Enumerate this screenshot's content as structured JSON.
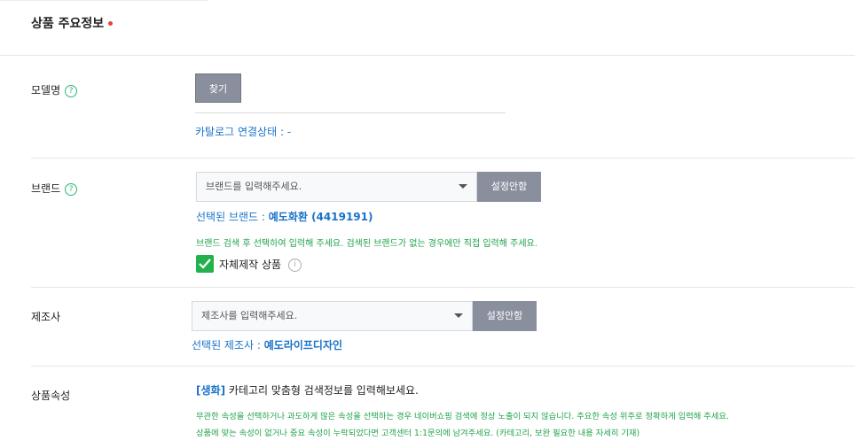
{
  "section": {
    "title": "상품 주요정보"
  },
  "model": {
    "label": "모델명",
    "help_icon": "?",
    "find_button": "찾기",
    "catalog_status": "카탈로그 연결상태 : -"
  },
  "brand": {
    "label": "브랜드",
    "help_icon": "?",
    "placeholder": "브랜드를 입력해주세요.",
    "set_button": "설정안함",
    "selected_prefix": "선택된 브랜드 : ",
    "selected_value": "예도화환 (4419191)",
    "guide": "브랜드 검색 후 선택하여 입력해 주세요. 검색된 브랜드가 없는 경우에만 직접 입력해 주세요.",
    "self_made_label": "자체제작 상품",
    "self_made_checked": true,
    "info_icon": "i"
  },
  "manufacturer": {
    "label": "제조사",
    "placeholder": "제조사를 입력해주세요.",
    "set_button": "설정안함",
    "selected_prefix": "선택된 제조사 : ",
    "selected_value": "예도라이프디자인"
  },
  "attributes": {
    "label": "상품속성",
    "category_tag": "[생화]",
    "intro": " 카테고리 맞춤형 검색정보를 입력해보세요.",
    "guide_line1": "무관한 속성을 선택하거나 과도하게 많은 속성을 선택하는 경우 네이버쇼핑 검색에 정상 노출이 되지 않습니다. 주요한 속성 위주로 정확하게 입력해 주세요.",
    "guide_line2": "상품에 맞는 속성이 없거나 중요 속성이 누락되었다면 고객센터 1:1문의에 남겨주세요. (카테고리, 보완 필요한 내용 자세히 기재)"
  },
  "colors": {
    "accent_green": "#22b14c",
    "link_blue": "#1a73c9",
    "button_gray": "#8a8f9e",
    "required_red": "#e8413c"
  }
}
